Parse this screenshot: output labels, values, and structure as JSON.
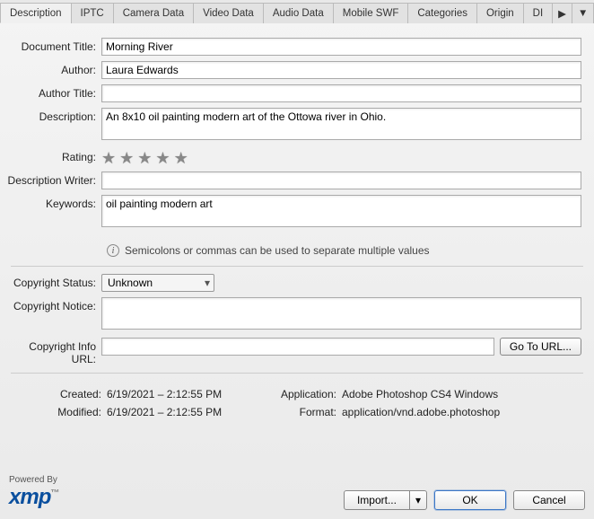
{
  "tabs": {
    "items": [
      "Description",
      "IPTC",
      "Camera Data",
      "Video Data",
      "Audio Data",
      "Mobile SWF",
      "Categories",
      "Origin",
      "DI"
    ],
    "active": 0
  },
  "labels": {
    "document_title": "Document Title:",
    "author": "Author:",
    "author_title": "Author Title:",
    "description": "Description:",
    "rating": "Rating:",
    "description_writer": "Description Writer:",
    "keywords": "Keywords:",
    "hint": "Semicolons or commas can be used to separate multiple values",
    "copyright_status": "Copyright Status:",
    "copyright_notice": "Copyright Notice:",
    "copyright_url": "Copyright Info URL:",
    "go_to_url": "Go To URL...",
    "created": "Created:",
    "modified": "Modified:",
    "application": "Application:",
    "format": "Format:",
    "powered_by": "Powered By",
    "import": "Import...",
    "ok": "OK",
    "cancel": "Cancel"
  },
  "values": {
    "document_title": "Morning River",
    "author": "Laura Edwards",
    "author_title": "",
    "description": "An 8x10 oil painting modern art of the Ottowa river in Ohio.",
    "description_writer": "",
    "keywords": "oil painting modern art",
    "copyright_status": "Unknown",
    "copyright_notice": "",
    "copyright_url": "",
    "created": "6/19/2021 – 2:12:55 PM",
    "modified": "6/19/2021 – 2:12:55 PM",
    "application": "Adobe Photoshop CS4 Windows",
    "format": "application/vnd.adobe.photoshop"
  },
  "logo": "xmp"
}
